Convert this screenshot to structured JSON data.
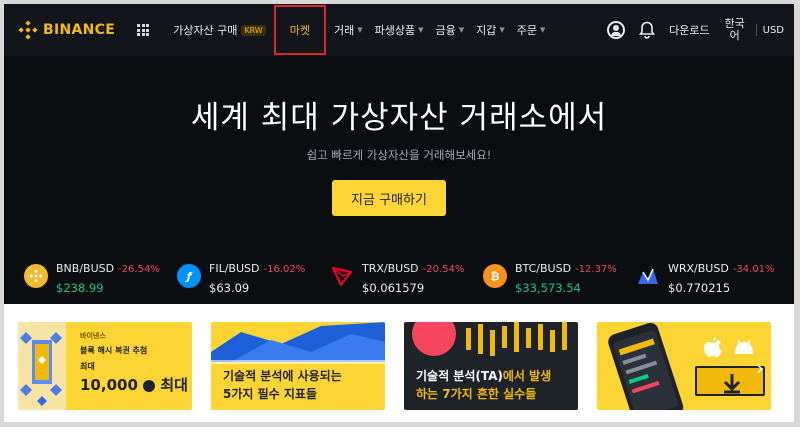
{
  "header": {
    "logo_text": "BINANCE",
    "nav": [
      {
        "label": "가상자산 구매",
        "badge": "KRW",
        "caret": false
      },
      {
        "label": "마켓",
        "caret": false,
        "highlight": true
      },
      {
        "label": "거래",
        "caret": true
      },
      {
        "label": "파생상품",
        "caret": true
      },
      {
        "label": "금융",
        "caret": true
      },
      {
        "label": "지갑",
        "caret": true
      },
      {
        "label": "주문",
        "caret": true
      }
    ],
    "download": "다운로드",
    "language": "한국어",
    "currency": "USD"
  },
  "hero": {
    "title": "세계 최대 가상자산 거래소에서",
    "subtitle": "쉽고 빠르게 가상자산을 거래해보세요!",
    "cta": "지금 구매하기"
  },
  "tickers": [
    {
      "pair": "BNB/BUSD",
      "change": "-26.54%",
      "price": "$238.99",
      "price_color": "#0ecb81",
      "icon": "bnb-coin-icon",
      "icon_color": "#f3ba2f"
    },
    {
      "pair": "FIL/BUSD",
      "change": "-16.02%",
      "price": "$63.09",
      "price_color": "#eaecef",
      "icon": "fil-coin-icon",
      "icon_color": "#0090ff"
    },
    {
      "pair": "TRX/BUSD",
      "change": "-20.54%",
      "price": "$0.061579",
      "price_color": "#eaecef",
      "icon": "trx-coin-icon",
      "icon_color": "#ef0027"
    },
    {
      "pair": "BTC/BUSD",
      "change": "-12.37%",
      "price": "$33,573.54",
      "price_color": "#0ecb81",
      "icon": "btc-coin-icon",
      "icon_color": "#f7931a"
    },
    {
      "pair": "WRX/BUSD",
      "change": "-34.01%",
      "price": "$0.770215",
      "price_color": "#eaecef",
      "icon": "wrx-coin-icon",
      "icon_color": "#3567e8"
    }
  ],
  "banners": {
    "b1": {
      "tag": "바이낸스",
      "line1": "블록 해시 복권 추첨",
      "line2": "최대",
      "amount": "10,000",
      "amount_suffix": "최대"
    },
    "b2": {
      "line1": "기술적 분석에 사용되는",
      "line2": "5가지 필수 지표들"
    },
    "b3": {
      "line1_a": "기술적 분석(TA)",
      "line1_b": "에서 발생",
      "line2": "하는 7가지 흔한 실수들"
    }
  },
  "colors": {
    "accent": "#f0b90b",
    "button": "#fcd535",
    "negative": "#f6465d",
    "positive": "#0ecb81"
  }
}
